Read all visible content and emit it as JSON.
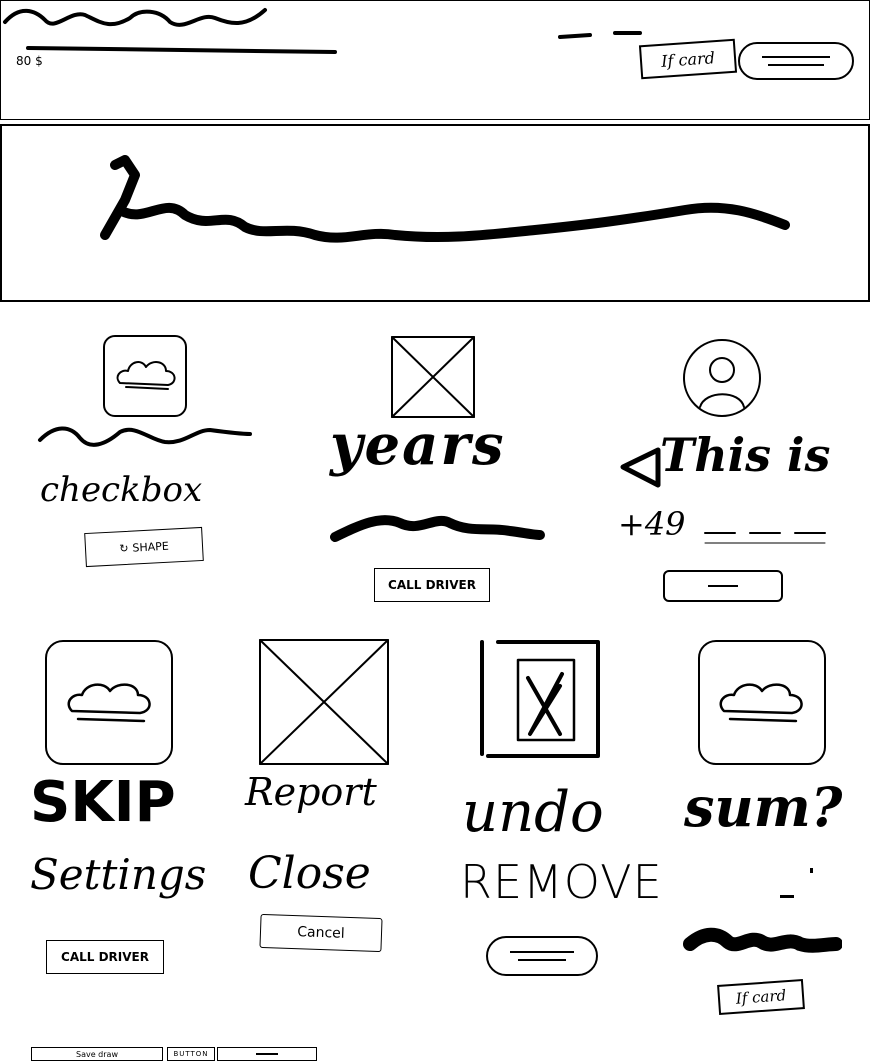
{
  "header": {
    "price": "80 $",
    "chip_label": "If card"
  },
  "card_a": {
    "button_label": "SHAPE"
  },
  "card_b": {
    "heading": "years",
    "button_label": "CALL DRIVER"
  },
  "card_c": {
    "heading": "This is",
    "phone": "+49"
  },
  "row2": {
    "col1": {
      "title": "SKIP",
      "subtitle": "Settings",
      "button_label": "CALL DRIVER"
    },
    "col2": {
      "title": "Report",
      "subtitle": "Close",
      "button_label": "Cancel"
    },
    "col3": {
      "title": "undo",
      "subtitle": "REMOVE"
    },
    "col4": {
      "title": "sum?",
      "chip_label": "If card"
    }
  },
  "footer": {
    "items": [
      "Save draw",
      "BUTTON"
    ]
  },
  "colors": {
    "ink": "#000000",
    "paper": "#ffffff"
  }
}
